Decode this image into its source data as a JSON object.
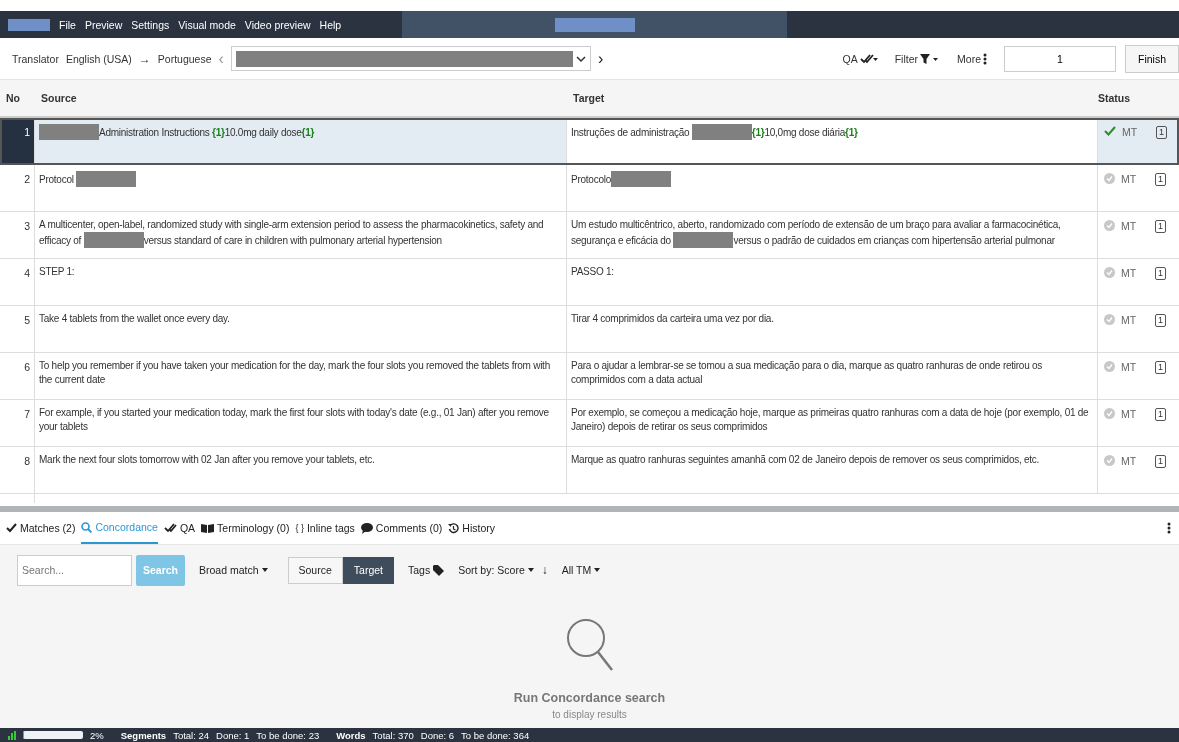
{
  "menu": {
    "items": [
      "File",
      "Preview",
      "Settings",
      "Visual mode",
      "Video preview",
      "Help"
    ]
  },
  "toolbar": {
    "role": "Translator",
    "source_language": "English (USA)",
    "arrow": "→",
    "target_language": "Portuguese",
    "prev": "‹",
    "next": "›",
    "qa": "QA",
    "filter": "Filter",
    "more": "More",
    "segment_value": "1",
    "finish": "Finish"
  },
  "table": {
    "columns": [
      "No",
      "Source",
      "Target",
      "Status"
    ],
    "rows": [
      {
        "no": "1",
        "selected": true,
        "confirmed": true,
        "status": "MT",
        "count": "1",
        "source": [
          {
            "kind": "redacted"
          },
          {
            "kind": "text",
            "text": "Administration Instructions "
          },
          {
            "kind": "tag",
            "text": "{1}"
          },
          {
            "kind": "text",
            "text": "10.0mg daily dose"
          },
          {
            "kind": "tag",
            "text": "{1}"
          }
        ],
        "target": [
          {
            "kind": "text",
            "text": "Instruções de administração "
          },
          {
            "kind": "redacted"
          },
          {
            "kind": "tag",
            "text": "{1}"
          },
          {
            "kind": "text",
            "text": "10,0mg dose diária"
          },
          {
            "kind": "tag",
            "text": "{1}"
          }
        ]
      },
      {
        "no": "2",
        "selected": false,
        "confirmed": false,
        "status": "MT",
        "count": "1",
        "source": [
          {
            "kind": "text",
            "text": "Protocol "
          },
          {
            "kind": "redacted"
          }
        ],
        "target": [
          {
            "kind": "text",
            "text": "Protocolo"
          },
          {
            "kind": "redacted"
          }
        ]
      },
      {
        "no": "3",
        "selected": false,
        "confirmed": false,
        "status": "MT",
        "count": "1",
        "source": [
          {
            "kind": "text",
            "text": "A multicenter, open-label, randomized study with single-arm extension period to assess the pharmacokinetics, safety and efficacy of "
          },
          {
            "kind": "redacted"
          },
          {
            "kind": "text",
            "text": "versus standard of care in children with pulmonary arterial hypertension"
          }
        ],
        "target": [
          {
            "kind": "text",
            "text": "Um estudo multicêntrico, aberto, randomizado com período de extensão de um braço para avaliar a farmacocinética, segurança e eficácia do "
          },
          {
            "kind": "redacted"
          },
          {
            "kind": "text",
            "text": "versus o padrão de cuidados em crianças com hipertensão arterial pulmonar"
          }
        ]
      },
      {
        "no": "4",
        "selected": false,
        "confirmed": false,
        "status": "MT",
        "count": "1",
        "source": [
          {
            "kind": "text",
            "text": "STEP 1:"
          }
        ],
        "target": [
          {
            "kind": "text",
            "text": "PASSO 1:"
          }
        ]
      },
      {
        "no": "5",
        "selected": false,
        "confirmed": false,
        "status": "MT",
        "count": "1",
        "source": [
          {
            "kind": "text",
            "text": "Take 4 tablets from the wallet once every day."
          }
        ],
        "target": [
          {
            "kind": "text",
            "text": "Tirar 4 comprimidos da carteira uma vez por dia."
          }
        ]
      },
      {
        "no": "6",
        "selected": false,
        "confirmed": false,
        "status": "MT",
        "count": "1",
        "source": [
          {
            "kind": "text",
            "text": "To help you remember if you have taken your medication for the day, mark the four slots you removed the tablets from with the current date"
          }
        ],
        "target": [
          {
            "kind": "text",
            "text": "Para o ajudar a lembrar-se se tomou a sua medicação para o dia, marque as quatro ranhuras de onde retirou os comprimidos com a data actual"
          }
        ]
      },
      {
        "no": "7",
        "selected": false,
        "confirmed": false,
        "status": "MT",
        "count": "1",
        "source": [
          {
            "kind": "text",
            "text": "For example, if you started your medication today, mark the first four slots with today's date (e.g., 01 Jan) after you remove your tablets"
          }
        ],
        "target": [
          {
            "kind": "text",
            "text": "Por exemplo, se começou a medicação hoje, marque as primeiras quatro ranhuras com a data de hoje (por exemplo, 01 de Janeiro) depois de retirar os seus comprimidos"
          }
        ]
      },
      {
        "no": "8",
        "selected": false,
        "confirmed": false,
        "status": "MT",
        "count": "1",
        "source": [
          {
            "kind": "text",
            "text": "Mark the next four slots tomorrow with 02 Jan after you remove your tablets, etc."
          }
        ],
        "target": [
          {
            "kind": "text",
            "text": "Marque as quatro ranhuras seguintes amanhã com 02 de Janeiro depois de remover os seus comprimidos, etc."
          }
        ]
      }
    ]
  },
  "panel_tabs": [
    {
      "kind": "check",
      "label": "Matches (2)",
      "selected": false
    },
    {
      "kind": "search",
      "label": "Concordance",
      "selected": true
    },
    {
      "kind": "qa",
      "label": "QA",
      "selected": false
    },
    {
      "kind": "book",
      "label": "Terminology (0)",
      "selected": false
    },
    {
      "kind": "glyph",
      "glyph": "{ }",
      "label": "Inline tags",
      "selected": false
    },
    {
      "kind": "comment",
      "label": "Comments (0)",
      "selected": false
    },
    {
      "kind": "history",
      "label": "History",
      "selected": false
    }
  ],
  "concordance": {
    "placeholder": "Search...",
    "search_button": "Search",
    "match_mode": "Broad match",
    "scopes": [
      {
        "label": "Source",
        "selected": false
      },
      {
        "label": "Target",
        "selected": true
      }
    ],
    "tags": "Tags",
    "sort": "Sort by: Score",
    "sort_arrow": "↓",
    "tm": "All TM",
    "empty_title": "Run Concordance search",
    "empty_hint": "to display results"
  },
  "status_bar": {
    "progress": {
      "level": 0.02,
      "reading": "2%"
    },
    "groups": [
      {
        "title": "Segments",
        "items": [
          "Total: 24",
          "Done: 1",
          "To be done: 23"
        ]
      },
      {
        "title": "Words",
        "items": [
          "Total: 370",
          "Done: 6",
          "To be done: 364"
        ]
      }
    ]
  }
}
